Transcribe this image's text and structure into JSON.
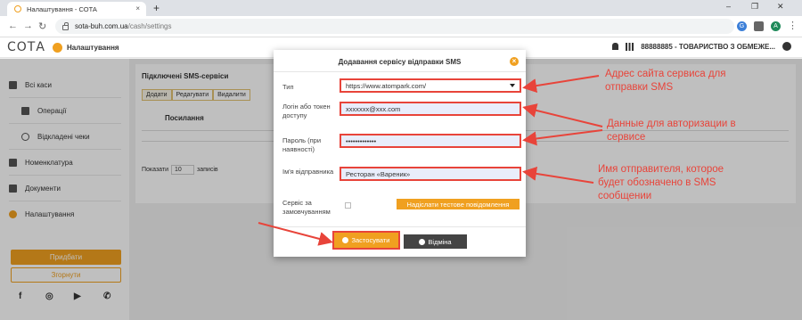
{
  "browser": {
    "tab_title": "Налаштування - СОТА",
    "tab_close": "×",
    "new_tab": "+",
    "url_host": "sota-buh.com.ua",
    "url_path": "/cash/settings",
    "profile_initial": "A"
  },
  "app": {
    "logo_text": "СОТА",
    "section_title": "Налаштування",
    "company": "88888885 - ТОВАРИСТВО З ОБМЕЖЕ..."
  },
  "sidebar": {
    "items": [
      {
        "label": "Всі каси"
      },
      {
        "label": "Операції"
      },
      {
        "label": "Відкладені чеки"
      },
      {
        "label": "Номенклатура"
      },
      {
        "label": "Документи"
      },
      {
        "label": "Налаштування"
      }
    ],
    "buy_label": "Придбати",
    "collapse_label": "Згорнути"
  },
  "main": {
    "title": "Підключені SMS-сервіси",
    "buttons": [
      "Додати",
      "Редагувати",
      "Видалити"
    ],
    "column_header": "Посилання",
    "show_label": "Показати",
    "show_value": "10",
    "records_label": "записів"
  },
  "modal": {
    "title": "Додавання сервісу відправки SMS",
    "close": "×",
    "type_label": "Тип",
    "type_value": "https://www.atompark.com/",
    "login_label": "Логін або токен доступу",
    "login_value": "xxxxxxx@xxx.com",
    "password_label": "Пароль (при наявності)",
    "password_value": "•••••••••••••",
    "sender_label": "Ім'я відправника",
    "sender_value": "Ресторан «Вареник»",
    "default_label": "Сервіс за замовчуванням",
    "test_button": "Надіслати тестове повідомлення",
    "apply_button": "Застосувати",
    "cancel_button": "Відміна"
  },
  "annotations": {
    "a1": "Адрес сайта сервиса для отправки SMS",
    "a2": "Данные для авторизации в сервисе",
    "a3": "Имя отправителя, которое будет обозначено в SMS сообщении"
  },
  "colors": {
    "accent": "#f0a020",
    "annotation": "#e8443a"
  }
}
